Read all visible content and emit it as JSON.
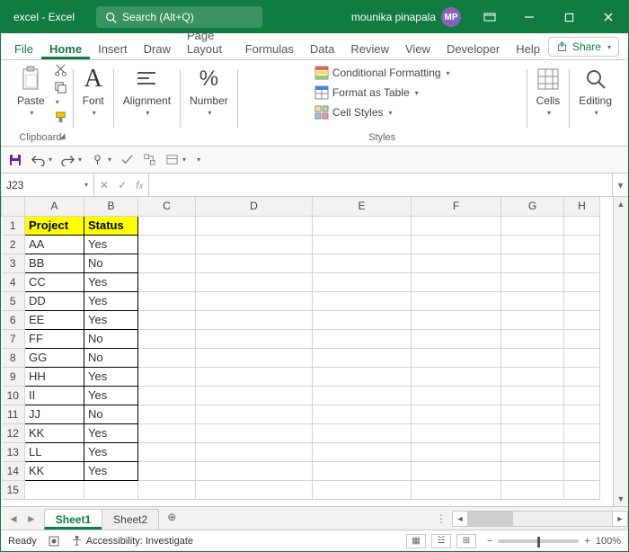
{
  "title": "excel - Excel",
  "search_placeholder": "Search (Alt+Q)",
  "user": {
    "name": "mounika pinapala",
    "initials": "MP"
  },
  "ribbon_tabs": {
    "file": "File",
    "items": [
      "Home",
      "Insert",
      "Draw",
      "Page Layout",
      "Formulas",
      "Data",
      "Review",
      "View",
      "Developer",
      "Help"
    ],
    "active": "Home",
    "share": "Share"
  },
  "ribbon_groups": {
    "clipboard": {
      "label": "Clipboard",
      "paste": "Paste"
    },
    "font": {
      "label": "Font"
    },
    "alignment": {
      "label": "Alignment"
    },
    "number": {
      "label": "Number"
    },
    "styles": {
      "label": "Styles",
      "cond": "Conditional Formatting",
      "table": "Format as Table",
      "cellstyles": "Cell Styles"
    },
    "cells": {
      "label": "Cells"
    },
    "editing": {
      "label": "Editing"
    }
  },
  "namebox": "J23",
  "formula": "",
  "columns": [
    "A",
    "B",
    "C",
    "D",
    "E",
    "F",
    "G",
    "H"
  ],
  "row_count_shown": 15,
  "sheet": {
    "headers": {
      "A": "Project",
      "B": "Status"
    },
    "rows": [
      {
        "A": "AA",
        "B": "Yes"
      },
      {
        "A": "BB",
        "B": "No"
      },
      {
        "A": "CC",
        "B": "Yes"
      },
      {
        "A": "DD",
        "B": "Yes"
      },
      {
        "A": "EE",
        "B": "Yes"
      },
      {
        "A": "FF",
        "B": "No"
      },
      {
        "A": "GG",
        "B": "No"
      },
      {
        "A": "HH",
        "B": "Yes"
      },
      {
        "A": "II",
        "B": "Yes"
      },
      {
        "A": "JJ",
        "B": "No"
      },
      {
        "A": "KK",
        "B": "Yes"
      },
      {
        "A": "LL",
        "B": "Yes"
      },
      {
        "A": "KK",
        "B": "Yes"
      }
    ]
  },
  "sheet_tabs": {
    "items": [
      "Sheet1",
      "Sheet2"
    ],
    "active": "Sheet1"
  },
  "status": {
    "ready": "Ready",
    "accessibility": "Accessibility: Investigate",
    "zoom": "100%"
  }
}
